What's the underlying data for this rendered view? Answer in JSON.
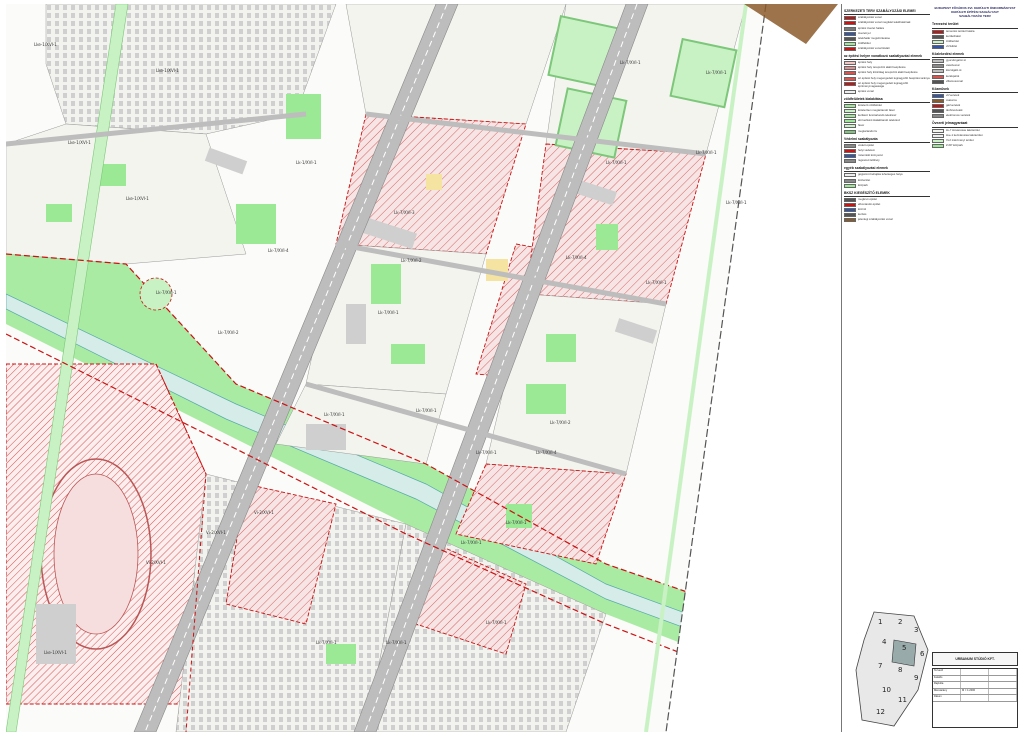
{
  "map": {
    "parcel_codes": [
      [
        "Lke-1/XVI-1",
        28,
        42
      ],
      [
        "Lke-1/XVI-1",
        150,
        68
      ],
      [
        "Lk-1/XVI-1",
        290,
        160
      ],
      [
        "Lk-7/XVI-4",
        262,
        248
      ],
      [
        "Lk-7/XVI-2",
        212,
        330
      ],
      [
        "Lk-7/XVI-1",
        318,
        412
      ],
      [
        "Lk-7/XVI-1",
        410,
        408
      ],
      [
        "Lk-7/XVI-1",
        470,
        450
      ],
      [
        "Lk-7/XVI-2",
        395,
        258
      ],
      [
        "Lk-7/XVI-3",
        388,
        210
      ],
      [
        "Lk-7/XVI-4",
        560,
        255
      ],
      [
        "Lk-7/XVI-4",
        530,
        450
      ],
      [
        "Lk-7/XVI-2",
        544,
        420
      ],
      [
        "Lke-1/XVI-1",
        120,
        196
      ],
      [
        "Lke-1/XVI-1",
        62,
        140
      ],
      [
        "Vi-2/XVI-1",
        248,
        510
      ],
      [
        "Vi-2/XVI-1",
        200,
        530
      ],
      [
        "Lk-7/XVI-1",
        372,
        310
      ],
      [
        "Lk-7/XVI-1",
        455,
        540
      ],
      [
        "Lk-7/XVI-1",
        500,
        520
      ],
      [
        "Lk-7/XVI-1",
        480,
        620
      ],
      [
        "Lk-7/XVI-1",
        380,
        640
      ],
      [
        "Lk-7/XVI-1",
        310,
        640
      ],
      [
        "Lke-1/XVI-1",
        38,
        650
      ],
      [
        "Lk-7/XVI-1",
        614,
        60
      ],
      [
        "Lk-7/XVI-1",
        700,
        70
      ],
      [
        "Lk-7/XVI-1",
        600,
        160
      ],
      [
        "Lk-7/XVI-1",
        690,
        150
      ],
      [
        "Lk-7/XVI-1",
        640,
        280
      ],
      [
        "Lk-7/XVI-1",
        720,
        200
      ],
      [
        "Vi-2/XVI-1",
        140,
        560
      ],
      [
        "Lk-7/XVI-1",
        150,
        290
      ]
    ],
    "colors": {
      "green_space": "#9be895",
      "green_light": "#c9f2c4",
      "road": "#bdbdbd",
      "road_dark": "#8a8a8a",
      "block_fill": "#f4f4ef",
      "building": "#cfcfcf",
      "hatch": "#d9534f",
      "boundary": "#cc1111",
      "channel": "#d6ece8",
      "brown": "#8b5a2b"
    }
  },
  "panel": {
    "legend_left": [
      {
        "head": "SZERKEZETI TERV SZABÁLYOZÁSI ELEMEI",
        "items": [
          {
            "c": "#cc1111",
            "t": "szabályozási vonal"
          },
          {
            "c": "#cc1111",
            "t": "szabályozási vonal megfelel telekhatárnak"
          },
          {
            "c": "#777777",
            "t": "építési övezet határa"
          },
          {
            "c": "#3355aa",
            "t": "övezeti jel"
          },
          {
            "c": "#555555",
            "t": "telekhatár megszüntetése"
          },
          {
            "c": "#9be895",
            "t": "zöldfelület"
          },
          {
            "c": "#cc1111",
            "t": "szabályozási vonal távlati"
          }
        ]
      },
      {
        "head": "az építési helyre vonatkozó szabályozási elemek",
        "items": [
          {
            "c": "#f4c7c3",
            "t": "építési hely"
          },
          {
            "c": "#e58c8c",
            "t": "építési hely terepszint alatti beépítésre"
          },
          {
            "c": "#d9534f",
            "t": "építési hely kizárólag terepszint alatti beépítésre"
          },
          {
            "c": "#d9534f",
            "t": "az építési hely megengedett legnagyobb beépítési aránya"
          },
          {
            "c": "#cc1111",
            "t": "az építési hely megengedett legnagyobb építménymagassága"
          },
          {
            "c": "#eeeeee",
            "t": "építési vonal"
          }
        ]
      },
      {
        "head": "zöldfelületek kialakítása",
        "items": [
          {
            "c": "#9be895",
            "t": "kötelező zöldfelület"
          },
          {
            "c": "#c9f2c4",
            "t": "kötelezően megtartandó fasor"
          },
          {
            "c": "#9be895",
            "t": "kertként fenntartandó telekrész"
          },
          {
            "c": "#9be895",
            "t": "elő kertként kialakítandó telekrész"
          },
          {
            "c": "#c9f2c4",
            "t": "fasor"
          },
          {
            "c": "#7cc77a",
            "t": "megtartandó fa"
          }
        ]
      },
      {
        "head": "Védelmi szabályozás",
        "items": [
          {
            "c": "#888888",
            "t": "védett épület"
          },
          {
            "c": "#cc1111",
            "t": "helyi védelem"
          },
          {
            "c": "#3355aa",
            "t": "műemléki környezet"
          },
          {
            "c": "#888888",
            "t": "régészeti lelőhely"
          }
        ]
      },
      {
        "head": "egyéb szabályozási elemek",
        "items": [
          {
            "c": "#eeeeee",
            "t": "gépjármű behajtás lehetséges helye"
          },
          {
            "c": "#888888",
            "t": "közterület"
          },
          {
            "c": "#9be895",
            "t": "közpark"
          }
        ]
      },
      {
        "head": "BKSZ KIEGÉSZÍTŐ ELEMEK",
        "items": [
          {
            "c": "#555555",
            "t": "meglévő épület"
          },
          {
            "c": "#cc1111",
            "t": "elbontandó épület"
          },
          {
            "c": "#3355aa",
            "t": "közmű"
          },
          {
            "c": "#555555",
            "t": "kerítés"
          },
          {
            "c": "#8b5a2b",
            "t": "jelenlegi szabályozási vonal"
          }
        ]
      }
    ],
    "legend_right": [
      {
        "head": "Tervezési terület",
        "items": [
          {
            "c": "#cc1111",
            "t": "tervezési terület határa"
          },
          {
            "c": "#555555",
            "t": "kerülethatár"
          },
          {
            "c": "#c9f2c4",
            "t": "zöldterület"
          },
          {
            "c": "#3355aa",
            "t": "vízfelület"
          }
        ]
      },
      {
        "head": "Közlekedési elemek",
        "items": [
          {
            "c": "#bdbdbd",
            "t": "gyorsforgalmi út"
          },
          {
            "c": "#8a8a8a",
            "t": "vasútvonal"
          },
          {
            "c": "#bdbdbd",
            "t": "kiszolgáló út"
          },
          {
            "c": "#d9534f",
            "t": "kerékpárút"
          },
          {
            "c": "#555555",
            "t": "villamosvonal"
          }
        ]
      },
      {
        "head": "Közművek",
        "items": [
          {
            "c": "#3355aa",
            "t": "vízvezeték"
          },
          {
            "c": "#8b5a2b",
            "t": "csatorna"
          },
          {
            "c": "#cc1111",
            "t": "gázvezeték"
          },
          {
            "c": "#555555",
            "t": "távhővezeték"
          },
          {
            "c": "#888888",
            "t": "elektromos vezeték"
          }
        ]
      },
      {
        "head": "Övezeti jelmagyarázat",
        "items": [
          {
            "c": "#f4f4ef",
            "t": "Lk-7 kisvárosias lakóterület"
          },
          {
            "c": "#eeeeee",
            "t": "Lke-1 kertvárosias lakóterület"
          },
          {
            "c": "#c9f2c4",
            "t": "Vi-2 intézményi terület"
          },
          {
            "c": "#9be895",
            "t": "Z-KP közpark"
          }
        ]
      }
    ],
    "title_lines": [
      "BUDAPEST FŐVÁROS XVI. KERÜLETI ÖNKORMÁNYZAT",
      "KERÜLETI ÉPÍTÉSI SZABÁLYZAT",
      "SZABÁLYOZÁSI TERV"
    ],
    "company": "URBANUM STÚDIÓ KFT.",
    "stamp_rows": [
      [
        "Tervező",
        "",
        ""
      ],
      [
        "Felelős",
        "",
        ""
      ],
      [
        "Rajzolta",
        "",
        ""
      ],
      [
        "Méretarány",
        "M = 1:2000",
        ""
      ],
      [
        "Dátum",
        "",
        ""
      ]
    ],
    "index_numbers": [
      "1",
      "2",
      "3",
      "4",
      "5",
      "6",
      "7",
      "8",
      "9",
      "10",
      "11",
      "12"
    ]
  }
}
